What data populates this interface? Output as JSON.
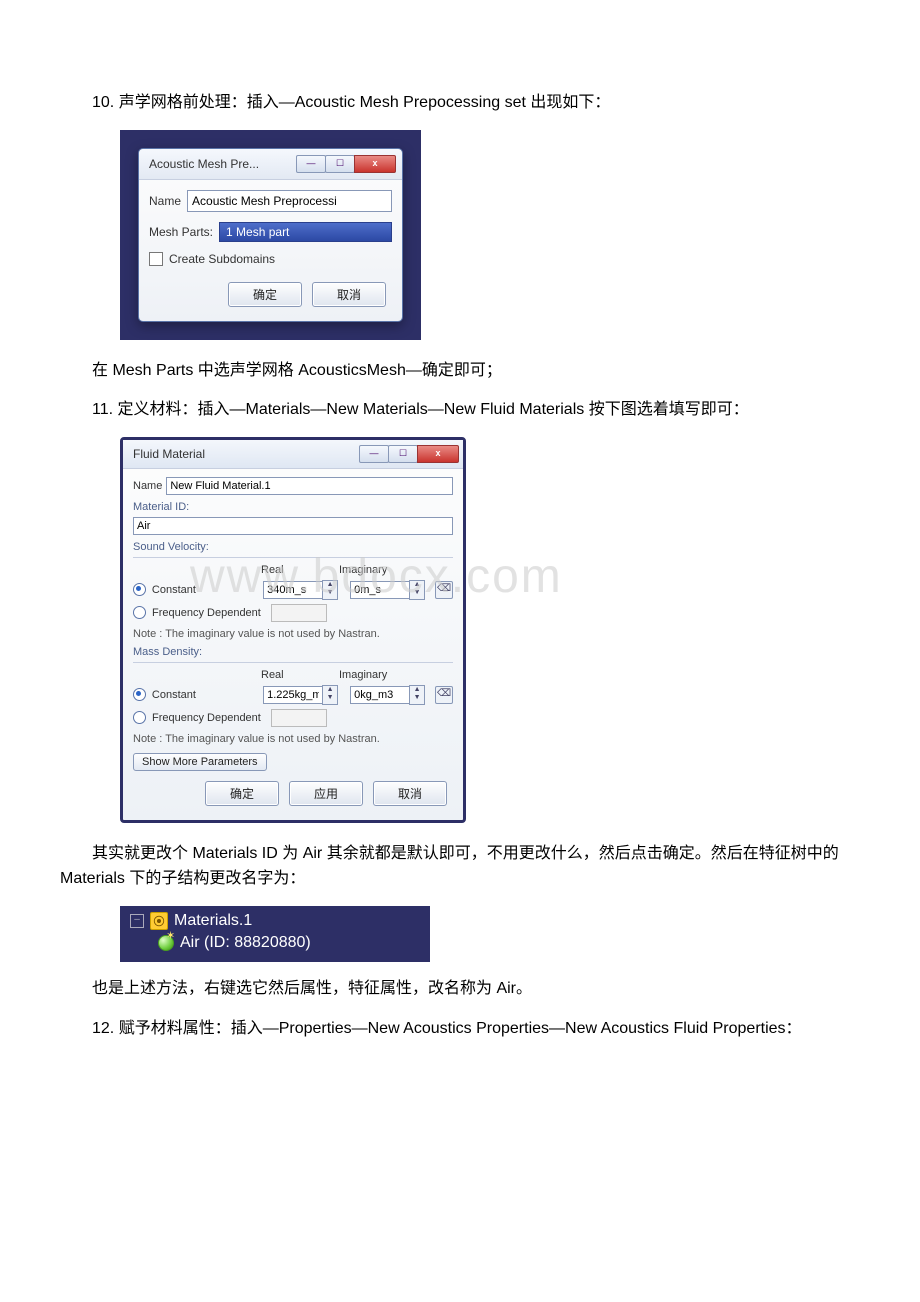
{
  "text": {
    "p1": "10. 声学网格前处理：插入—Acoustic Mesh Prepocessing set 出现如下：",
    "p2": "在 Mesh Parts 中选声学网格 AcousticsMesh—确定即可；",
    "p3": "11. 定义材料：插入—Materials—New Materials—New Fluid Materials 按下图选着填写即可：",
    "p4": "其实就更改个 Materials ID 为 Air 其余就都是默认即可，不用更改什么，然后点击确定。然后在特征树中的 Materials 下的子结构更改名字为：",
    "p5": "也是上述方法，右键选它然后属性，特征属性，改名称为 Air。",
    "p6": "12. 赋予材料属性：插入—Properties—New Acoustics Properties—New Acoustics Fluid Properties："
  },
  "dlg1": {
    "title": "Acoustic Mesh Pre...",
    "name_label": "Name",
    "name_value": "Acoustic Mesh Preprocessi",
    "meshparts_label": "Mesh Parts:",
    "meshparts_value": "1 Mesh part",
    "create_subdomains": "Create Subdomains",
    "ok": "确定",
    "cancel": "取消",
    "win_min": "—",
    "win_max": "☐",
    "win_close": "x"
  },
  "dlg2": {
    "title": "Fluid Material",
    "name_label": "Name",
    "name_value": "New Fluid Material.1",
    "material_id_label": "Material ID:",
    "material_id_value": "Air",
    "sv_section": "Sound Velocity:",
    "col_real": "Real",
    "col_imag": "Imaginary",
    "constant": "Constant",
    "freq_dep": "Frequency Dependent",
    "sv_real": "340m_s",
    "sv_imag": "0m_s",
    "note": "Note : The imaginary value is not used by Nastran.",
    "md_section": "Mass Density:",
    "md_real": "1.225kg_m",
    "md_imag": "0kg_m3",
    "show_more": "Show More Parameters",
    "ok": "确定",
    "apply": "应用",
    "cancel": "取消",
    "win_min": "—",
    "win_max": "☐",
    "win_close": "x"
  },
  "tree": {
    "node1": "Materials.1",
    "node2": "Air (ID: 88820880)"
  },
  "watermark": "www.bdocx.com"
}
